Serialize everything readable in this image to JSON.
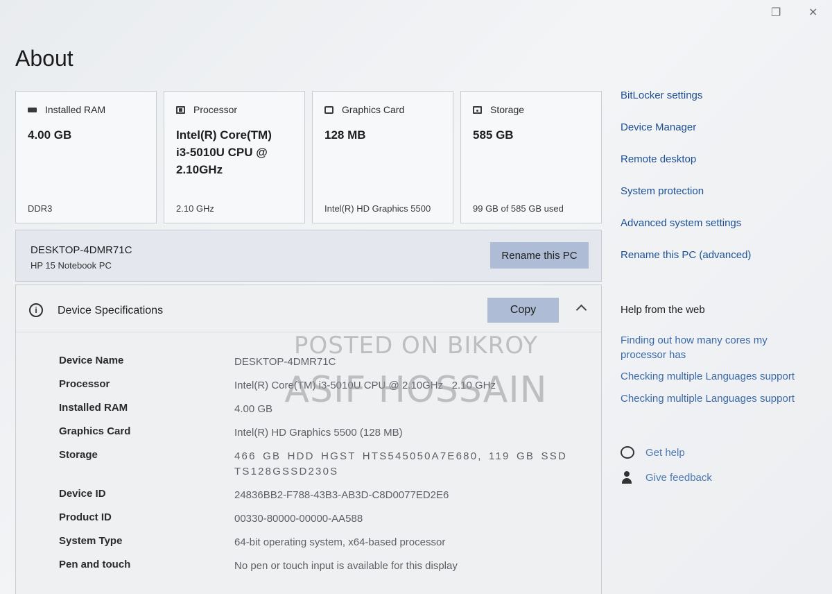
{
  "window": {
    "restore_glyph": "❐",
    "close_glyph": "✕"
  },
  "page_title": "About",
  "cards": [
    {
      "icon": "memory-icon",
      "label": "Installed RAM",
      "value": "4.00 GB",
      "sub": "DDR3"
    },
    {
      "icon": "processor-icon",
      "label": "Processor",
      "value": "Intel(R) Core(TM) i3-5010U CPU @ 2.10GHz",
      "sub": "2.10 GHz"
    },
    {
      "icon": "graphics-card-icon",
      "label": "Graphics Card",
      "value": "128 MB",
      "sub": "Intel(R) HD Graphics 5500"
    },
    {
      "icon": "storage-icon",
      "label": "Storage",
      "value": "585 GB",
      "sub": "99 GB of 585 GB used"
    }
  ],
  "pc": {
    "name": "DESKTOP-4DMR71C",
    "model": "HP 15 Notebook PC",
    "rename_label": "Rename this PC"
  },
  "specs": {
    "title": "Device Specifications",
    "copy_label": "Copy",
    "info_glyph": "i",
    "rows": [
      {
        "label": "Device Name",
        "value": "DESKTOP-4DMR71C"
      },
      {
        "label": "Processor",
        "value": "Intel(R) Core(TM) i3-5010U CPU @ 2.10GHz   2.10 GHz"
      },
      {
        "label": "Installed RAM",
        "value": "4.00 GB"
      },
      {
        "label": "Graphics Card",
        "value": "Intel(R) HD Graphics 5500 (128 MB)"
      },
      {
        "label": "Storage",
        "value": "466 GB HDD HGST HTS545050A7E680, 119 GB SSD TS128GSSD230S"
      },
      {
        "label": "Device ID",
        "value": "24836BB2-F788-43B3-AB3D-C8D0077ED2E6"
      },
      {
        "label": "Product ID",
        "value": "00330-80000-00000-AA588"
      },
      {
        "label": "System Type",
        "value": "64-bit operating system, x64-based processor"
      },
      {
        "label": "Pen and touch",
        "value": "No pen or touch input is available for this display"
      }
    ]
  },
  "related_links": [
    "BitLocker settings",
    "Device Manager",
    "Remote desktop",
    "System protection",
    "Advanced system settings",
    "Rename this PC (advanced)"
  ],
  "help_web": {
    "heading": "Help from the web",
    "links": [
      "Finding out how many cores my processor has",
      "Checking multiple Languages support",
      "Checking multiple Languages support"
    ]
  },
  "help_actions": [
    {
      "icon": "get-help-icon",
      "label": "Get help"
    },
    {
      "icon": "feedback-icon",
      "label": "Give feedback"
    }
  ],
  "watermark": {
    "line1": "POSTED ON BIKROY",
    "line2": "ASIF HOSSAIN"
  }
}
